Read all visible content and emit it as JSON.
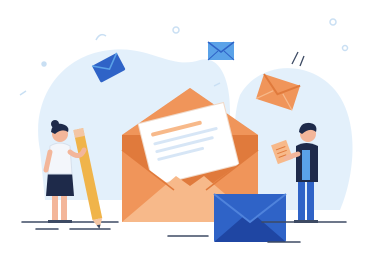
{
  "illustration": {
    "subject": "email-newsletter-illustration",
    "colors": {
      "background": "#ffffff",
      "blob": "#e3f0fb",
      "envelope_orange": "#f0955a",
      "envelope_orange_light": "#f7b98a",
      "envelope_orange_dark": "#e07a3c",
      "letter_paper": "#ffffff",
      "envelope_blue": "#2f63c7",
      "envelope_blue_dark": "#1f46a3",
      "skin": "#f3b69a",
      "hair": "#1e2a4a",
      "accent_blue": "#5aa2e8",
      "ground_line": "#3d4a63"
    },
    "icons": [
      "open-orange-envelope-icon",
      "letter-icon",
      "closed-blue-envelope-icon",
      "small-blue-envelope-icon",
      "small-orange-envelope-icon",
      "woman-with-pencil",
      "man-holding-letter"
    ]
  }
}
